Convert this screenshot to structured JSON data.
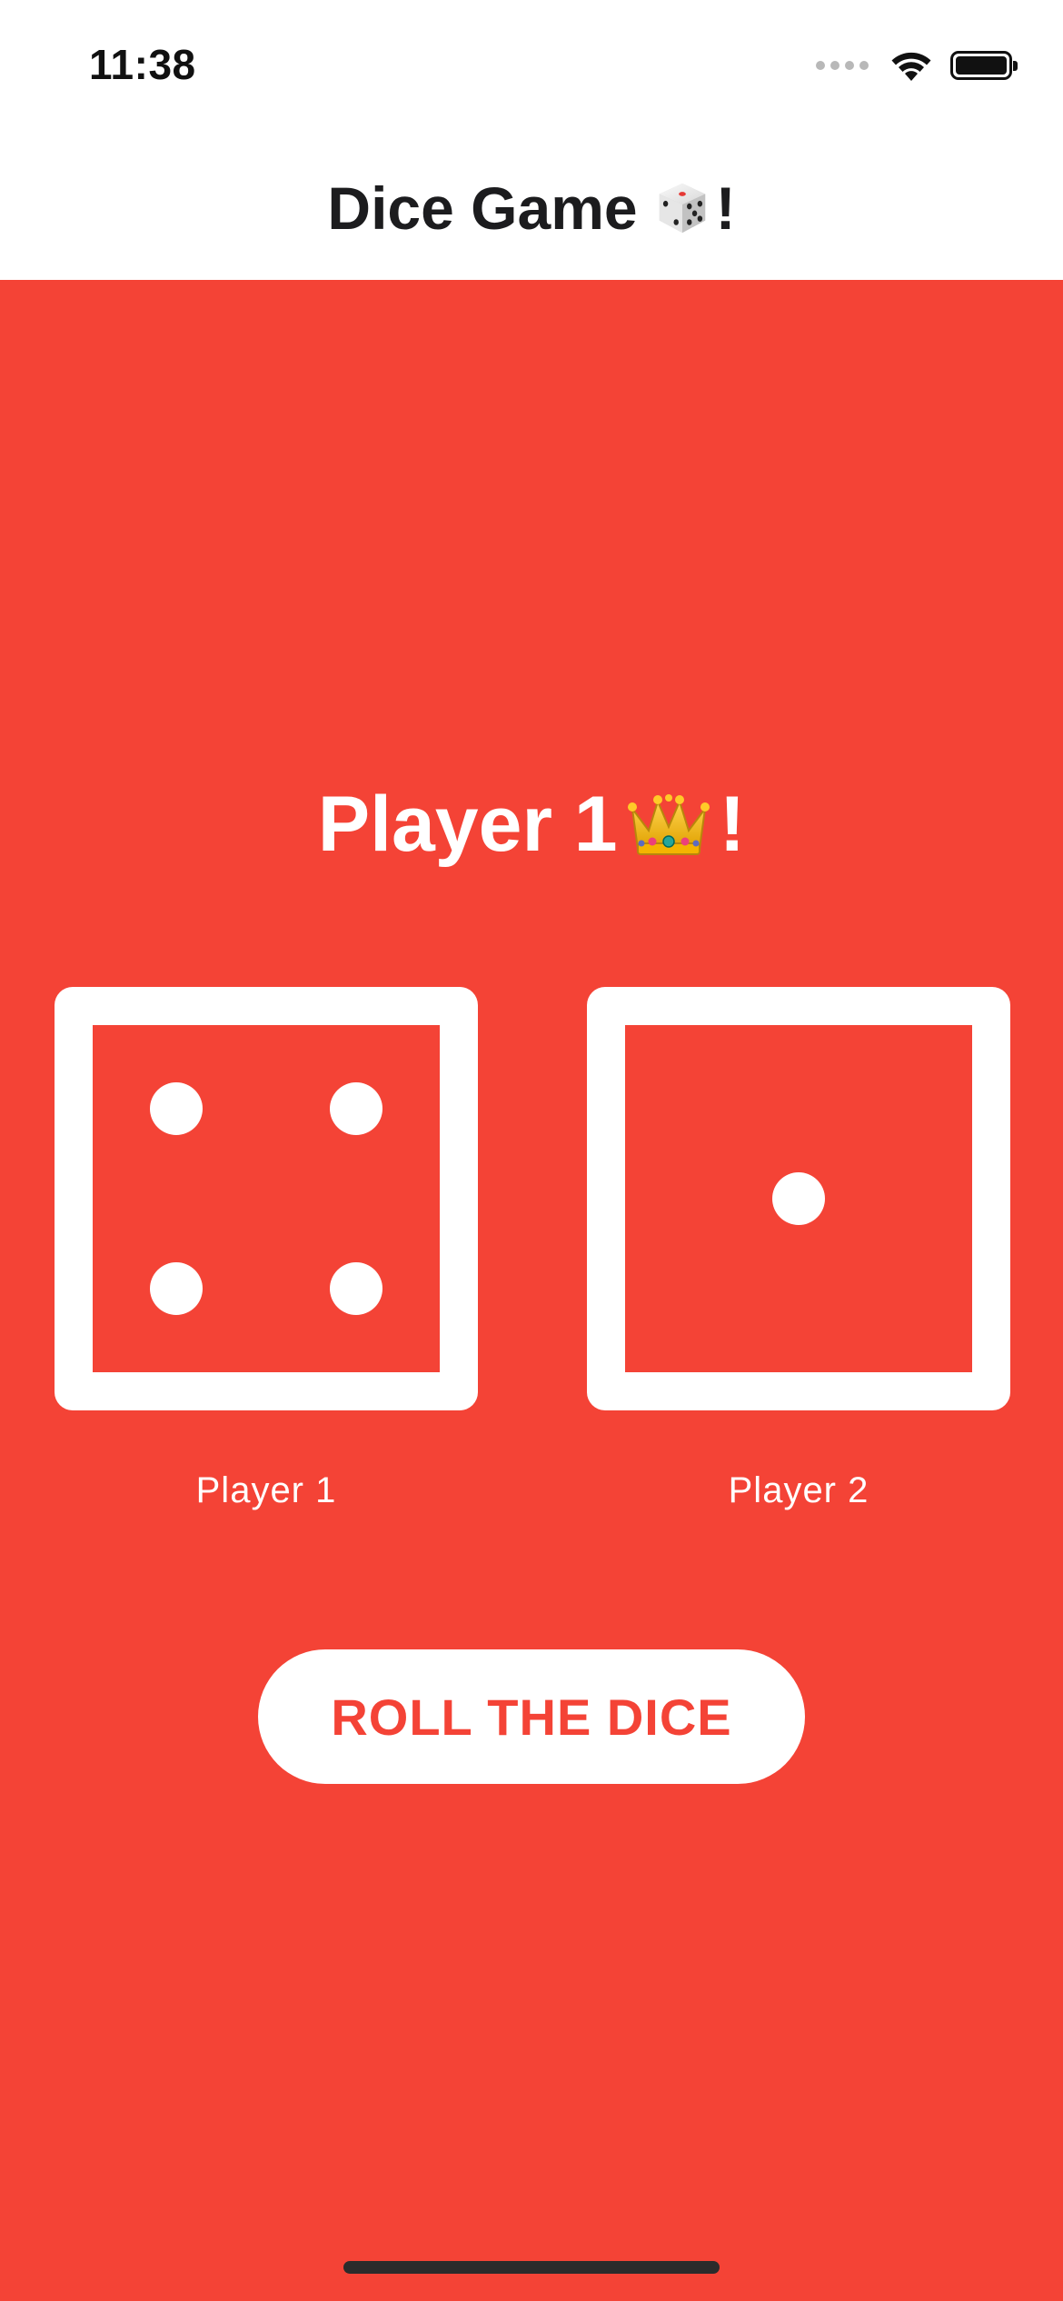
{
  "status_bar": {
    "time": "11:38"
  },
  "header": {
    "title_text": "Dice Game ",
    "title_suffix": "!"
  },
  "result": {
    "winner_text": "Player 1 ",
    "winner_suffix": "!"
  },
  "dice": [
    {
      "player_label": "Player 1",
      "value": 4
    },
    {
      "player_label": "Player 2",
      "value": 1
    }
  ],
  "actions": {
    "roll_label": "ROLL THE DICE"
  },
  "colors": {
    "background": "#f44336",
    "foreground": "#ffffff",
    "header_text": "#1c1c1e"
  },
  "icons": {
    "title_icon": "game-die-icon",
    "winner_icon": "crown-icon"
  }
}
